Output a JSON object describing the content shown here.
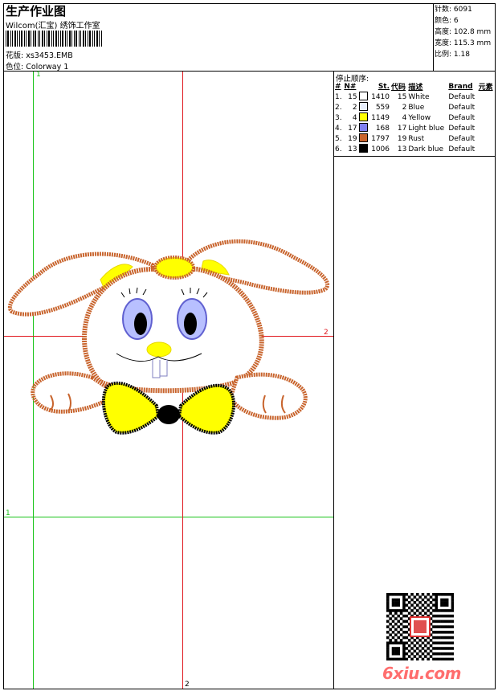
{
  "header": {
    "title": "生产作业图",
    "studio": "Wilcom(汇宝) 绣饰工作室",
    "pattern_label": "花版:",
    "pattern_value": "xs3453.EMB",
    "colorway_label": "色位:",
    "colorway_value": "Colorway 1"
  },
  "stats": {
    "stitches_label": "针数:",
    "stitches_value": "6091",
    "colors_label": "颜色:",
    "colors_value": "6",
    "height_label": "高度:",
    "height_value": "102.8 mm",
    "width_label": "宽度:",
    "width_value": "115.3 mm",
    "scale_label": "比例:",
    "scale_value": "1.18"
  },
  "sequence": {
    "heading": "停止顺序:",
    "columns": [
      "#",
      "N#",
      "St.",
      "代码",
      "描述",
      "Brand",
      "元素"
    ],
    "rows": [
      {
        "idx": "1.",
        "n": "15",
        "st": "1410",
        "code": "15",
        "desc": "White",
        "brand": "Default",
        "color": "#ffffff"
      },
      {
        "idx": "2.",
        "n": "2",
        "st": "559",
        "code": "2",
        "desc": "Blue",
        "brand": "Default",
        "color": "#e8eefc"
      },
      {
        "idx": "3.",
        "n": "4",
        "st": "1149",
        "code": "4",
        "desc": "Yellow",
        "brand": "Default",
        "color": "#ffff00"
      },
      {
        "idx": "4.",
        "n": "17",
        "st": "168",
        "code": "17",
        "desc": "Light blue",
        "brand": "Default",
        "color": "#8080f0"
      },
      {
        "idx": "5.",
        "n": "19",
        "st": "1797",
        "code": "19",
        "desc": "Rust",
        "brand": "Default",
        "color": "#c8642d"
      },
      {
        "idx": "6.",
        "n": "13",
        "st": "1006",
        "code": "13",
        "desc": "Dark blue",
        "brand": "Default",
        "color": "#000000"
      }
    ]
  },
  "guides": {
    "green_top_label": "1",
    "green_left_label": "1",
    "red_right_label": "2",
    "red_bottom_label": "2"
  },
  "watermark": "6xiu.com",
  "colors": {
    "guide_red": "#e0161d",
    "guide_green": "#19c419",
    "rust": "#c8642d",
    "yellow": "#ffff00"
  }
}
